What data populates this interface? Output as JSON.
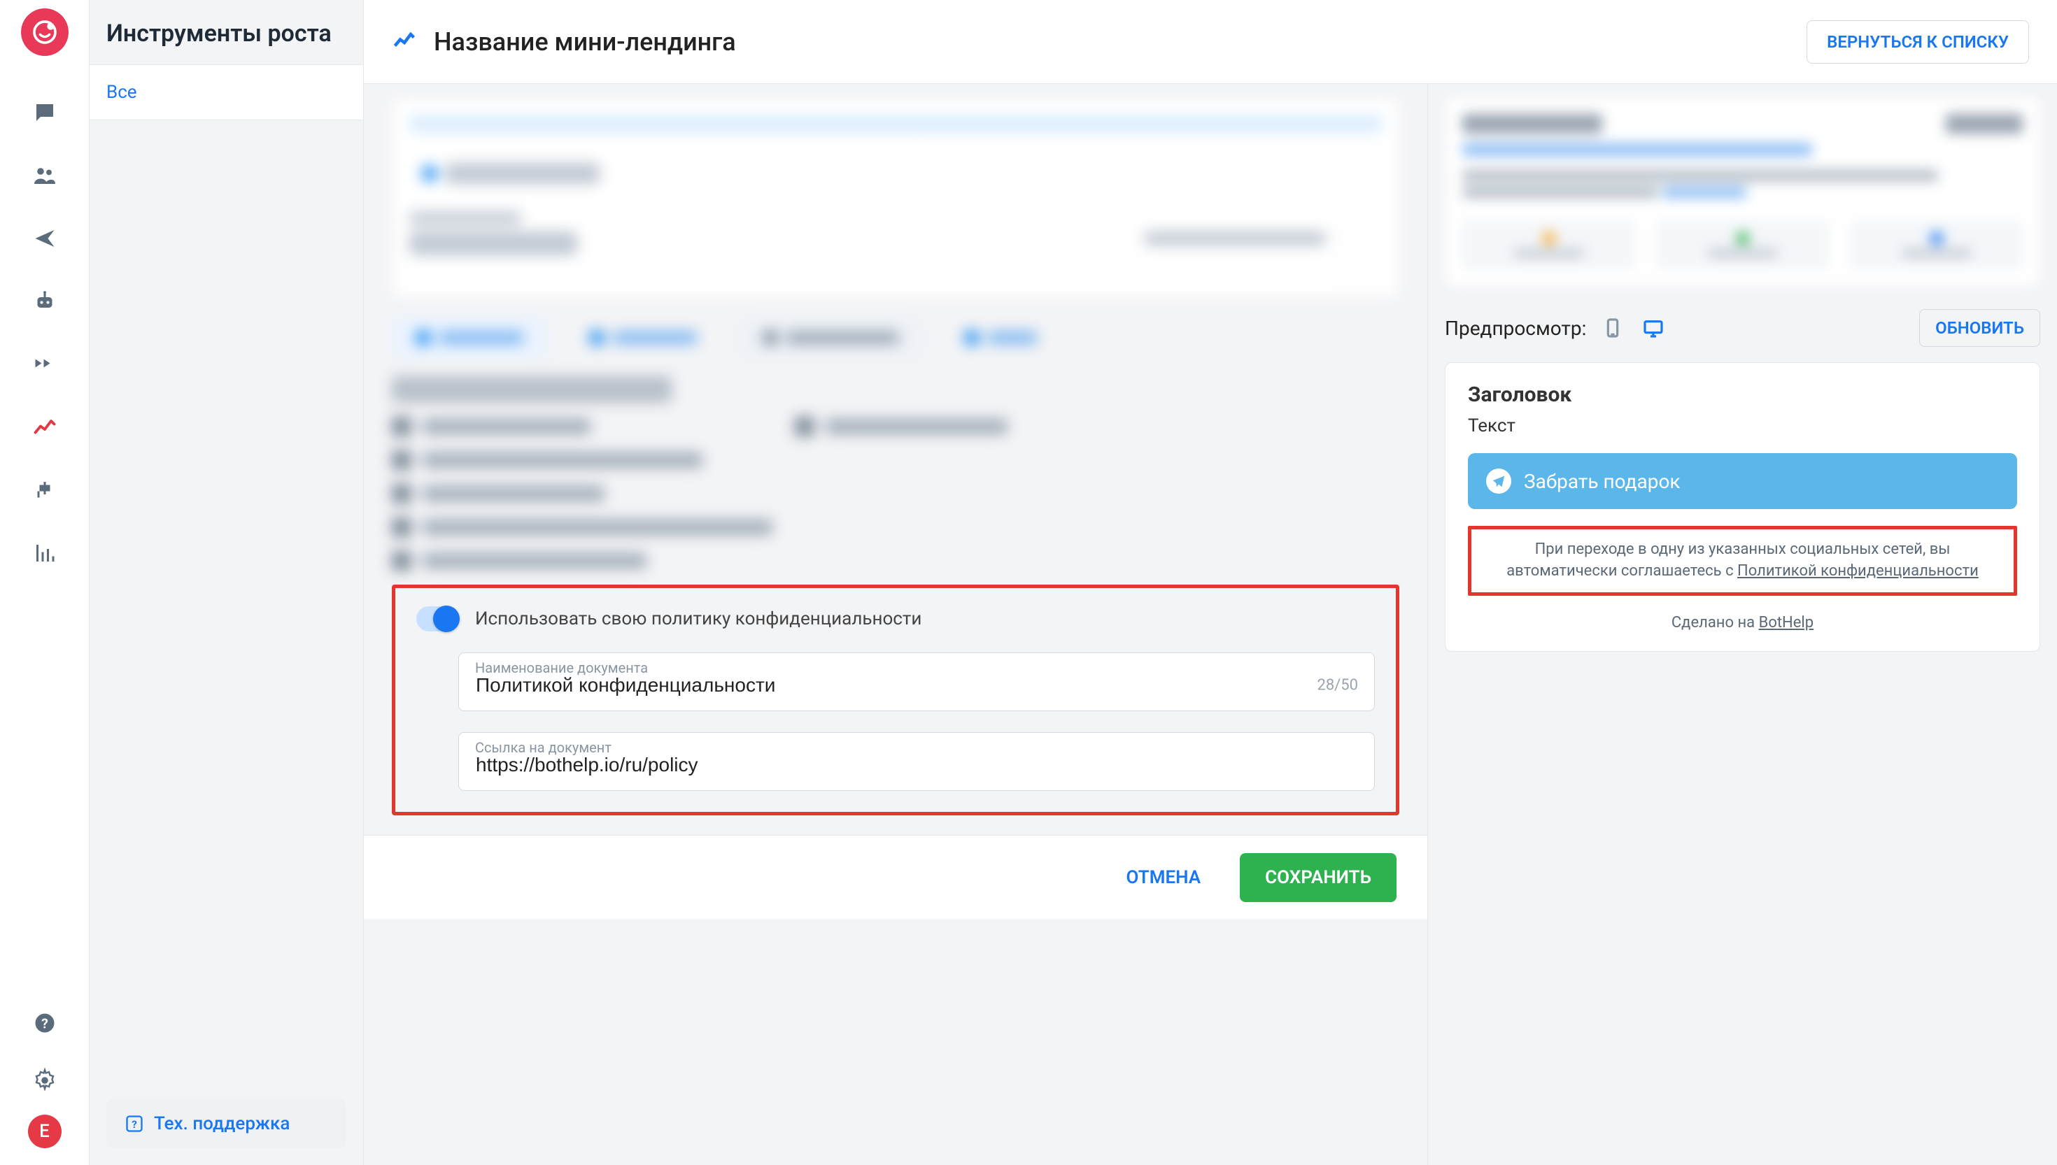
{
  "sidebar": {
    "avatar_letter": "E"
  },
  "leftcol": {
    "title": "Инструменты роста",
    "tab_all": "Все",
    "support": "Тех. поддержка"
  },
  "topbar": {
    "title": "Название мини-лендинга",
    "back": "ВЕРНУТЬСЯ К СПИСКУ"
  },
  "policy": {
    "toggle_label": "Использовать свою политику конфиденциальности",
    "docname_label": "Наименование документа",
    "docname_value": "Политикой конфиденциальности",
    "docname_counter": "28/50",
    "link_label": "Ссылка на документ",
    "link_value": "https://bothelp.io/ru/policy"
  },
  "footer": {
    "cancel": "ОТМЕНА",
    "save": "СОХРАНИТЬ"
  },
  "preview": {
    "bar_label": "Предпросмотр:",
    "refresh": "ОБНОВИТЬ",
    "card": {
      "heading": "Заголовок",
      "text": "Текст",
      "cta": "Забрать подарок",
      "consent_a": "При переходе в одну из указанных социальных сетей, вы автоматически соглашаетесь с ",
      "consent_link": "Политикой конфиденциальности",
      "made_a": "Сделано на ",
      "made_link": "BotHelp"
    }
  }
}
